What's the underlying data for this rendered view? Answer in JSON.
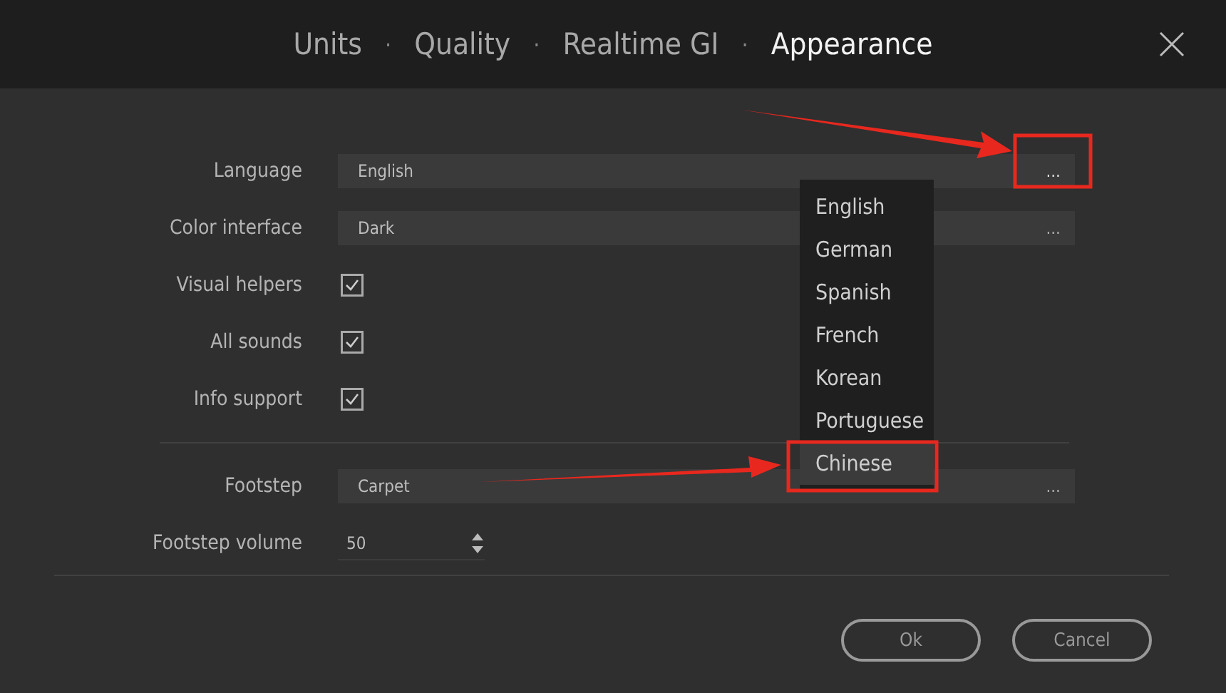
{
  "header": {
    "items": [
      {
        "kind": "tab",
        "label": "Units",
        "selected": false
      },
      {
        "kind": "separator",
        "label": "·"
      },
      {
        "kind": "tab",
        "label": "Quality",
        "selected": false
      },
      {
        "kind": "separator",
        "label": "·"
      },
      {
        "kind": "tab",
        "label": "Realtime GI",
        "selected": false
      },
      {
        "kind": "separator",
        "label": "·"
      },
      {
        "kind": "tab",
        "label": "Appearance",
        "selected": true
      }
    ]
  },
  "settings_groups": [
    [
      {
        "kind": "select",
        "label": "Language",
        "value": "English",
        "more": "...",
        "highlighted": true
      },
      {
        "kind": "select",
        "label": "Color interface",
        "value": "Dark",
        "more": "...",
        "highlighted": false
      },
      {
        "kind": "checkbox",
        "label": "Visual helpers",
        "checked": true
      },
      {
        "kind": "checkbox",
        "label": "All sounds",
        "checked": true
      },
      {
        "kind": "checkbox",
        "label": "Info support",
        "checked": true
      }
    ],
    [
      {
        "kind": "select",
        "label": "Footstep",
        "value": "Carpet",
        "more": "...",
        "highlighted": false
      },
      {
        "kind": "spinner",
        "label": "Footstep volume",
        "value": "50"
      }
    ]
  ],
  "dropdown": {
    "items": [
      {
        "label": "English",
        "selected": false
      },
      {
        "label": "German",
        "selected": false
      },
      {
        "label": "Spanish",
        "selected": false
      },
      {
        "label": "French",
        "selected": false
      },
      {
        "label": "Korean",
        "selected": false
      },
      {
        "label": "Portuguese",
        "selected": false
      },
      {
        "label": "Chinese",
        "selected": true
      }
    ]
  },
  "buttons": [
    "Ok",
    "Cancel"
  ]
}
